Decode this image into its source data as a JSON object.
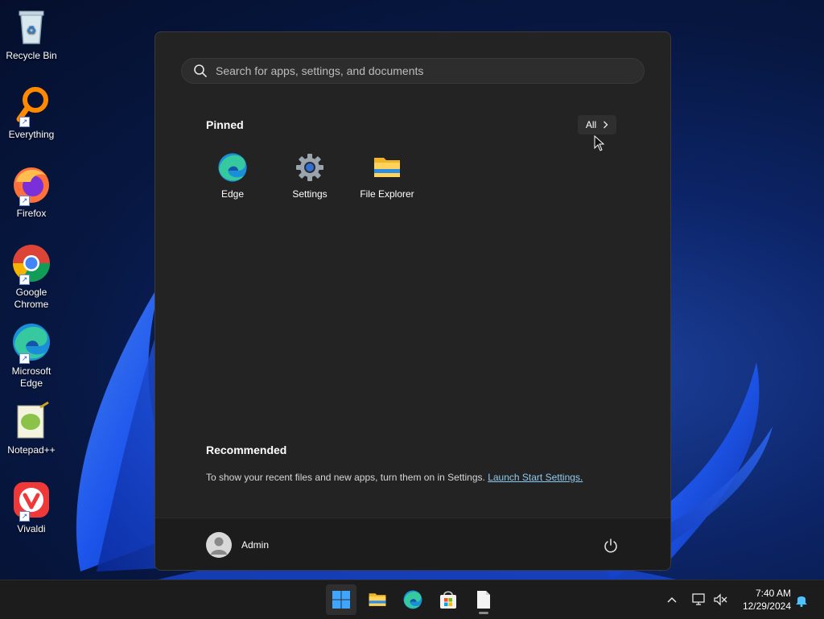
{
  "desktop": {
    "icons": [
      {
        "label": "Recycle Bin"
      },
      {
        "label": "Everything"
      },
      {
        "label": "Firefox"
      },
      {
        "label": "Google Chrome"
      },
      {
        "label": "Microsoft Edge"
      },
      {
        "label": "Notepad++"
      },
      {
        "label": "Vivaldi"
      }
    ]
  },
  "start_menu": {
    "search_placeholder": "Search for apps, settings, and documents",
    "pinned_title": "Pinned",
    "all_label": "All",
    "pinned_apps": [
      {
        "label": "Edge",
        "icon": "edge-icon"
      },
      {
        "label": "Settings",
        "icon": "gear-icon"
      },
      {
        "label": "File Explorer",
        "icon": "folder-icon"
      }
    ],
    "recommended_title": "Recommended",
    "recommended_text": "To show your recent files and new apps, turn them on in Settings.",
    "recommended_link": "Launch Start Settings.",
    "user_name": "Admin"
  },
  "taskbar": {
    "apps": [
      "start-icon",
      "file-explorer-icon",
      "edge-icon",
      "store-icon",
      "notepad-icon"
    ],
    "time": "7:40 AM",
    "date": "12/29/2024"
  }
}
